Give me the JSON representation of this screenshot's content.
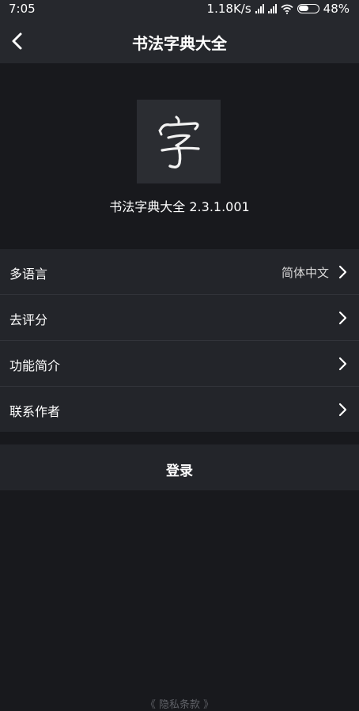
{
  "status_bar": {
    "time": "7:05",
    "network_speed": "1.18K/s",
    "battery": "48%"
  },
  "header": {
    "title": "书法字典大全"
  },
  "about": {
    "icon_glyph": "字",
    "version_text": "书法字典大全 2.3.1.001"
  },
  "menu": {
    "items": [
      {
        "label": "多语言",
        "value": "简体中文"
      },
      {
        "label": "去评分"
      },
      {
        "label": "功能简介"
      },
      {
        "label": "联系作者"
      }
    ]
  },
  "login": {
    "label": "登录"
  },
  "footer": {
    "privacy_link": "《 隐私条款 》"
  },
  "colors": {
    "background": "#18191d",
    "bar_background": "#26282d",
    "list_background": "#23252a",
    "divider": "#32343a",
    "muted_text": "#5e6066"
  }
}
